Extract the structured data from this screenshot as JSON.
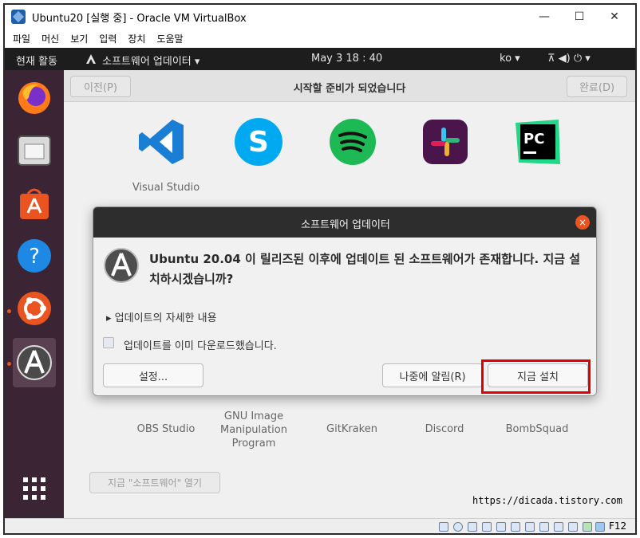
{
  "window": {
    "title": "Ubuntu20 [실행 중] - Oracle VM VirtualBox",
    "controls": {
      "minimize": "—",
      "maximize": "☐",
      "close": "✕"
    }
  },
  "menubar": [
    "파일",
    "머신",
    "보기",
    "입력",
    "장치",
    "도움말"
  ],
  "guest_topbar": {
    "activities": "현재 활동",
    "app_menu": "소프트웨어 업데이터 ▾",
    "clock": "May 3  18 : 40",
    "input_method": "ko ▾",
    "system_icons": "⊼  ◀)  ⏻ ▾"
  },
  "dock": {
    "items": [
      "firefox-icon",
      "files-icon",
      "software-center-icon",
      "help-icon",
      "ubuntu-software-icon",
      "software-updater-icon"
    ],
    "apps_grid_icon": "show-applications-icon"
  },
  "software": {
    "back_label": "이전(P)",
    "title": "시작할 준비가 되었습니다",
    "done_label": "완료(D)",
    "top_apps": [
      "Visual Studio",
      "Skype",
      "Spotify",
      "Slack",
      "PyCharm CE"
    ],
    "bottom_apps": [
      "OBS Studio",
      "GNU Image\nManipulation\nProgram",
      "GitKraken",
      "Discord",
      "BombSquad"
    ],
    "open_label": "지금 \"소프트웨어\" 열기"
  },
  "dialog": {
    "title": "소프트웨어 업데이터",
    "message": "Ubuntu 20.04 이 릴리즈된 이후에 업데이트 된 소프트웨어가 존재합니다. 지금 설치하시겠습니까?",
    "details": "업데이트의 자세한 내용",
    "checkbox_label": "업데이트를 이미 다운로드했습니다.",
    "settings_label": "설정...",
    "remind_label": "나중에 알림(R)",
    "install_label": "지금 설치",
    "close": "×"
  },
  "watermark": "https://dicada.tistory.com",
  "statusbar": {
    "host_key": "F12"
  },
  "colors": {
    "accent": "#e95420",
    "highlight": "#e00000",
    "dock": "#3b2433",
    "topbar": "#1d1d1d"
  }
}
